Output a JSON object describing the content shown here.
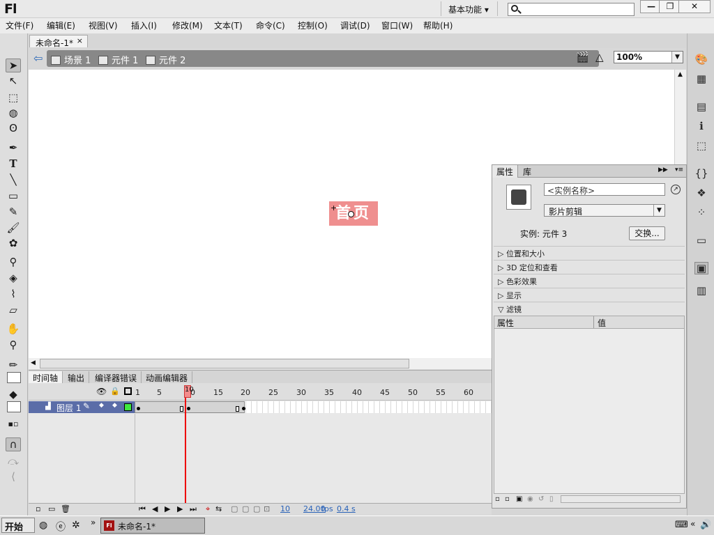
{
  "app": {
    "logo": "Fl",
    "workspace": "基本功能",
    "workspace_arrow": "▾"
  },
  "window_buttons": {
    "minimize": "—",
    "restore": "❐",
    "close": "✕"
  },
  "menu": [
    "文件(F)",
    "编辑(E)",
    "视图(V)",
    "插入(I)",
    "修改(M)",
    "文本(T)",
    "命令(C)",
    "控制(O)",
    "调试(D)",
    "窗口(W)",
    "帮助(H)"
  ],
  "document": {
    "tab_title": "未命名-1*",
    "tab_close": "×"
  },
  "breadcrumb": {
    "items": [
      "场景 1",
      "元件 1",
      "元件 2"
    ]
  },
  "zoom": {
    "value": "100%"
  },
  "stage": {
    "button_text": "首页",
    "button_color": "#ef8f8f"
  },
  "timeline": {
    "tabs": [
      "时间轴",
      "输出",
      "编译器错误",
      "动画编辑器"
    ],
    "frame_numbers": [
      "1",
      "5",
      "10",
      "15",
      "20",
      "25",
      "30",
      "35",
      "40",
      "45",
      "50",
      "55",
      "60"
    ],
    "layer_name": "图层 1",
    "current_frame": "10",
    "fps": "24.00",
    "fps_unit": "fps",
    "elapsed": "0.4 s"
  },
  "properties": {
    "tabs": [
      "属性",
      "库"
    ],
    "instance_name_placeholder": "<实例名称>",
    "instance_type": "影片剪辑",
    "instance_of": "实例: 元件 3",
    "swap_button": "交换...",
    "sections": [
      "位置和大小",
      "3D 定位和查看",
      "色彩效果",
      "显示",
      "滤镜"
    ],
    "filter_columns": [
      "属性",
      "值"
    ]
  },
  "taskbar": {
    "start": "开始",
    "task_item": "未命名-1*"
  },
  "colors": {
    "layer_row": "#5b6da8",
    "playhead": "#e00000",
    "keyframe_box": "#f38b8b"
  }
}
